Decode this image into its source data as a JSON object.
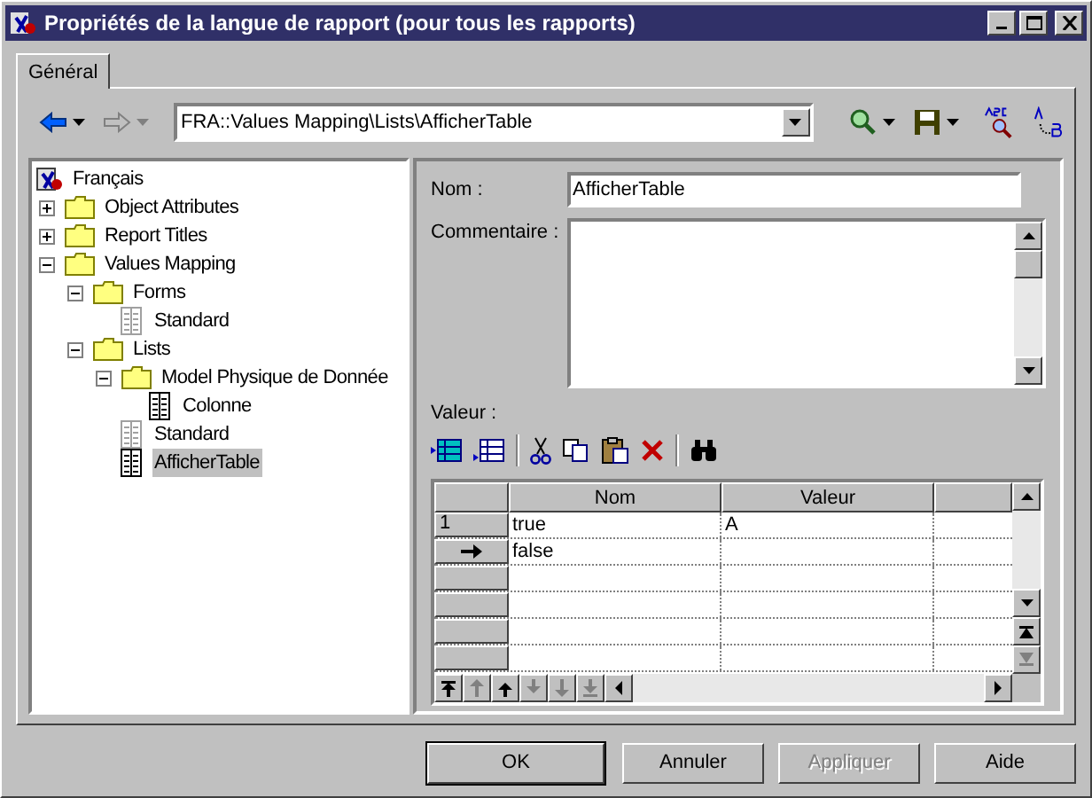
{
  "window": {
    "title": "Propriétés de la langue de rapport (pour tous les rapports)"
  },
  "tabs": [
    {
      "label": "Général",
      "selected": true
    }
  ],
  "toolbar": {
    "nav": [
      {
        "kind": "back",
        "disabled": false
      },
      {
        "kind": "forward",
        "disabled": true
      }
    ],
    "path": "FRA::Values Mapping\\Lists\\AfficherTable"
  },
  "tree": [
    {
      "label": "Français",
      "kind": "root",
      "selected": false,
      "children": [
        {
          "label": "Object Attributes",
          "kind": "folder",
          "expanded": false,
          "selected": false
        },
        {
          "label": "Report Titles",
          "kind": "folder",
          "expanded": false,
          "selected": false
        },
        {
          "label": "Values Mapping",
          "kind": "folder",
          "expanded": true,
          "selected": false,
          "children": [
            {
              "label": "Forms",
              "kind": "folder",
              "expanded": true,
              "selected": false,
              "children": [
                {
                  "label": "Standard",
                  "kind": "template",
                  "selected": false
                }
              ]
            },
            {
              "label": "Lists",
              "kind": "folder",
              "expanded": true,
              "selected": false,
              "children": [
                {
                  "label": "Model Physique de Donnée",
                  "kind": "folder",
                  "expanded": true,
                  "selected": false,
                  "children": [
                    {
                      "label": "Colonne",
                      "kind": "item",
                      "selected": false
                    }
                  ]
                },
                {
                  "label": "Standard",
                  "kind": "template",
                  "selected": false
                },
                {
                  "label": "AfficherTable",
                  "kind": "item",
                  "selected": true
                }
              ]
            }
          ]
        }
      ]
    }
  ],
  "form": {
    "name_label": "Nom :",
    "name_value": "AfficherTable",
    "comment_label": "Commentaire :",
    "value_label": "Valeur :"
  },
  "grid": {
    "columns": [
      "Nom",
      "Valeur"
    ],
    "rows": [
      {
        "number": "1",
        "current": false,
        "cells": [
          "true",
          "A"
        ]
      },
      {
        "current": true,
        "cells": [
          "false",
          ""
        ]
      }
    ]
  },
  "buttons": [
    {
      "label": "OK",
      "default": true,
      "disabled": false
    },
    {
      "label": "Annuler",
      "default": false,
      "disabled": false
    },
    {
      "label": "Appliquer",
      "default": false,
      "disabled": true
    },
    {
      "label": "Aide",
      "default": false,
      "disabled": false
    }
  ]
}
